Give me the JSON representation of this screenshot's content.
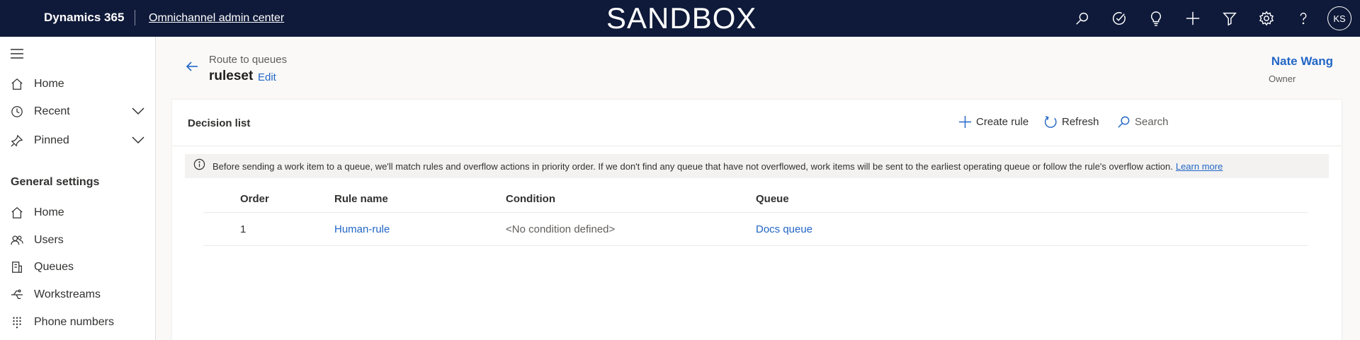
{
  "topbar": {
    "brand": "Dynamics 365",
    "app_name": "Omnichannel admin center",
    "environment": "SANDBOX",
    "icons": [
      "search-icon",
      "task-icon",
      "lightbulb-icon",
      "plus-icon",
      "filter-icon",
      "gear-icon",
      "help-icon"
    ],
    "avatar_initials": "KS"
  },
  "sidebar": {
    "items": [
      {
        "label": "Home",
        "icon": "home-icon"
      },
      {
        "label": "Recent",
        "icon": "clock-icon",
        "expandable": true
      },
      {
        "label": "Pinned",
        "icon": "pin-icon",
        "expandable": true
      }
    ],
    "section_title": "General settings",
    "general_items": [
      {
        "label": "Home",
        "icon": "home-icon"
      },
      {
        "label": "Users",
        "icon": "users-icon"
      },
      {
        "label": "Queues",
        "icon": "queues-icon"
      },
      {
        "label": "Workstreams",
        "icon": "workstreams-icon"
      },
      {
        "label": "Phone numbers",
        "icon": "keypad-icon"
      }
    ]
  },
  "header": {
    "breadcrumb": "Route to queues",
    "title": "ruleset",
    "edit_label": "Edit",
    "owner_name": "Nate Wang",
    "owner_label": "Owner"
  },
  "card": {
    "title": "Decision list",
    "commands": {
      "create_rule": "Create rule",
      "refresh": "Refresh",
      "search": "Search"
    },
    "info_text": "Before sending a work item to a queue, we'll match rules and overflow actions in priority order. If we don't find any queue that have not overflowed, work items will be sent to the earliest operating queue or follow the rule's overflow action.",
    "learn_more": "Learn more",
    "table": {
      "columns": [
        "Order",
        "Rule name",
        "Condition",
        "Queue"
      ],
      "rows": [
        {
          "order": "1",
          "rule_name": "Human-rule",
          "condition": "<No condition defined>",
          "queue": "Docs queue"
        }
      ]
    }
  },
  "colors": {
    "topbar_bg": "#0f1a3a",
    "accent": "#2266c6"
  }
}
